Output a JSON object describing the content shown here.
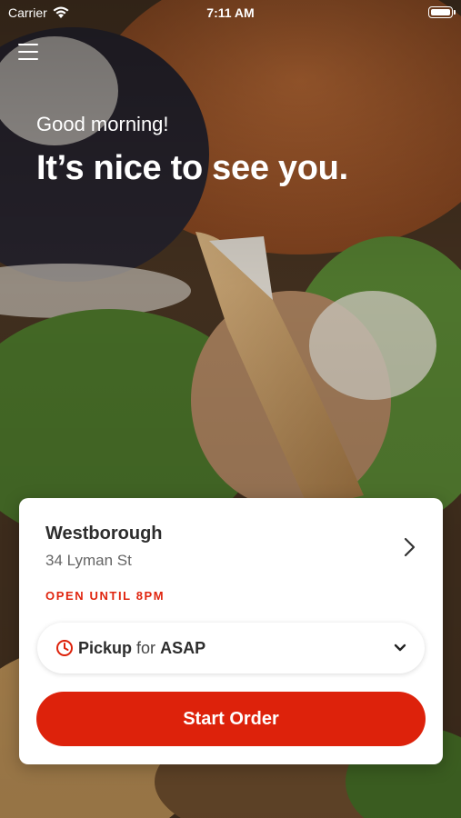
{
  "status_bar": {
    "carrier": "Carrier",
    "time": "7:11 AM"
  },
  "hero": {
    "greeting": "Good morning!",
    "headline": "It’s nice to see you."
  },
  "location": {
    "name": "Westborough",
    "address": "34 Lyman St",
    "hours": "OPEN UNTIL 8PM"
  },
  "order_mode": {
    "mode": "Pickup",
    "connector": "for",
    "time": "ASAP"
  },
  "start_button_label": "Start Order",
  "colors": {
    "accent": "#dd220b",
    "hours_text": "#e0250f"
  },
  "icons": {
    "menu": "hamburger-menu-icon",
    "location_chevron": "chevron-right-icon",
    "clock": "clock-icon",
    "dropdown": "chevron-down-icon",
    "wifi": "wifi-icon",
    "battery": "battery-icon"
  }
}
